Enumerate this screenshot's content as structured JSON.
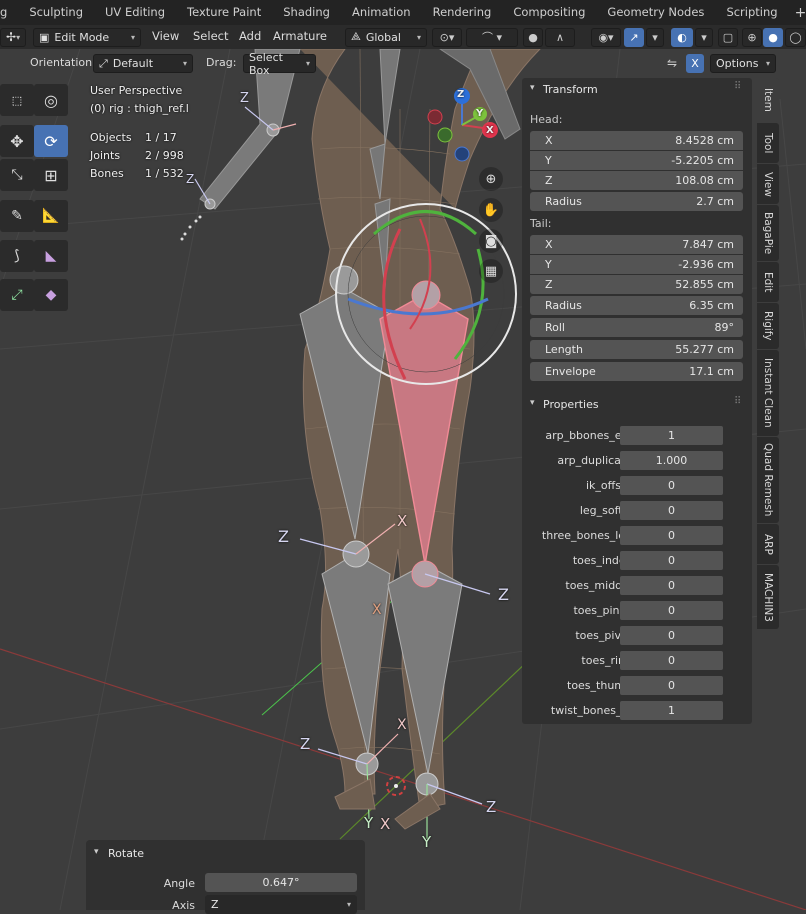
{
  "workspace_tabs": [
    "g",
    "Sculpting",
    "UV Editing",
    "Texture Paint",
    "Shading",
    "Animation",
    "Rendering",
    "Compositing",
    "Geometry Nodes",
    "Scripting"
  ],
  "header": {
    "mode": "Edit Mode",
    "menus": [
      "View",
      "Select",
      "Add",
      "Armature"
    ],
    "transform_orientation": "Global"
  },
  "header2": {
    "orientation_label": "Orientation:",
    "orientation_value": "Default",
    "drag_label": "Drag:",
    "drag_value": "Select Box",
    "x_toggle": "X",
    "options": "Options"
  },
  "viewport_info": {
    "perspective": "User Perspective",
    "object": "(0) rig : thigh_ref.l",
    "objects_label": "Objects",
    "objects_value": "1 / 17",
    "joints_label": "Joints",
    "joints_value": "2 / 998",
    "bones_label": "Bones",
    "bones_value": "1 / 532"
  },
  "gizmo": {
    "x": "X",
    "y": "Y",
    "z": "Z"
  },
  "axis_labels": {
    "x": "X",
    "y": "Y",
    "z": "Z"
  },
  "transform": {
    "title": "Transform",
    "head_label": "Head:",
    "head": [
      {
        "label": "X",
        "value": "8.4528 cm"
      },
      {
        "label": "Y",
        "value": "-5.2205 cm"
      },
      {
        "label": "Z",
        "value": "108.08 cm"
      }
    ],
    "head_radius": {
      "label": "Radius",
      "value": "2.7 cm"
    },
    "tail_label": "Tail:",
    "tail": [
      {
        "label": "X",
        "value": "7.847 cm"
      },
      {
        "label": "Y",
        "value": "-2.936 cm"
      },
      {
        "label": "Z",
        "value": "52.855 cm"
      }
    ],
    "tail_extra": [
      {
        "label": "Radius",
        "value": "6.35 cm"
      },
      {
        "label": "Roll",
        "value": "89°"
      },
      {
        "label": "Length",
        "value": "55.277 cm"
      },
      {
        "label": "Envelope",
        "value": "17.1 cm"
      }
    ]
  },
  "properties": {
    "title": "Properties",
    "rows": [
      {
        "label": "arp_bbones_e...",
        "value": "1"
      },
      {
        "label": "arp_duplicate",
        "value": "1.000"
      },
      {
        "label": "ik_offset",
        "value": "0"
      },
      {
        "label": "leg_softik",
        "value": "0"
      },
      {
        "label": "three_bones_leg",
        "value": "0"
      },
      {
        "label": "toes_index",
        "value": "0"
      },
      {
        "label": "toes_middle",
        "value": "0"
      },
      {
        "label": "toes_pinky",
        "value": "0"
      },
      {
        "label": "toes_pivot",
        "value": "0"
      },
      {
        "label": "toes_ring",
        "value": "0"
      },
      {
        "label": "toes_thumb",
        "value": "0"
      },
      {
        "label": "twist_bones_...",
        "value": "1"
      }
    ]
  },
  "sidebar_tabs": [
    "Item",
    "Tool",
    "View",
    "BagaPie",
    "Edit",
    "Rigify",
    "Instant Clean",
    "Quad Remesh",
    "ARP",
    "MACHIN3"
  ],
  "rotate_panel": {
    "title": "Rotate",
    "angle_label": "Angle",
    "angle_value": "0.647°",
    "axis_label": "Axis",
    "axis_value": "Z"
  },
  "colors": {
    "accent": "#4772b3",
    "selected_bone": "#e05a6a"
  }
}
